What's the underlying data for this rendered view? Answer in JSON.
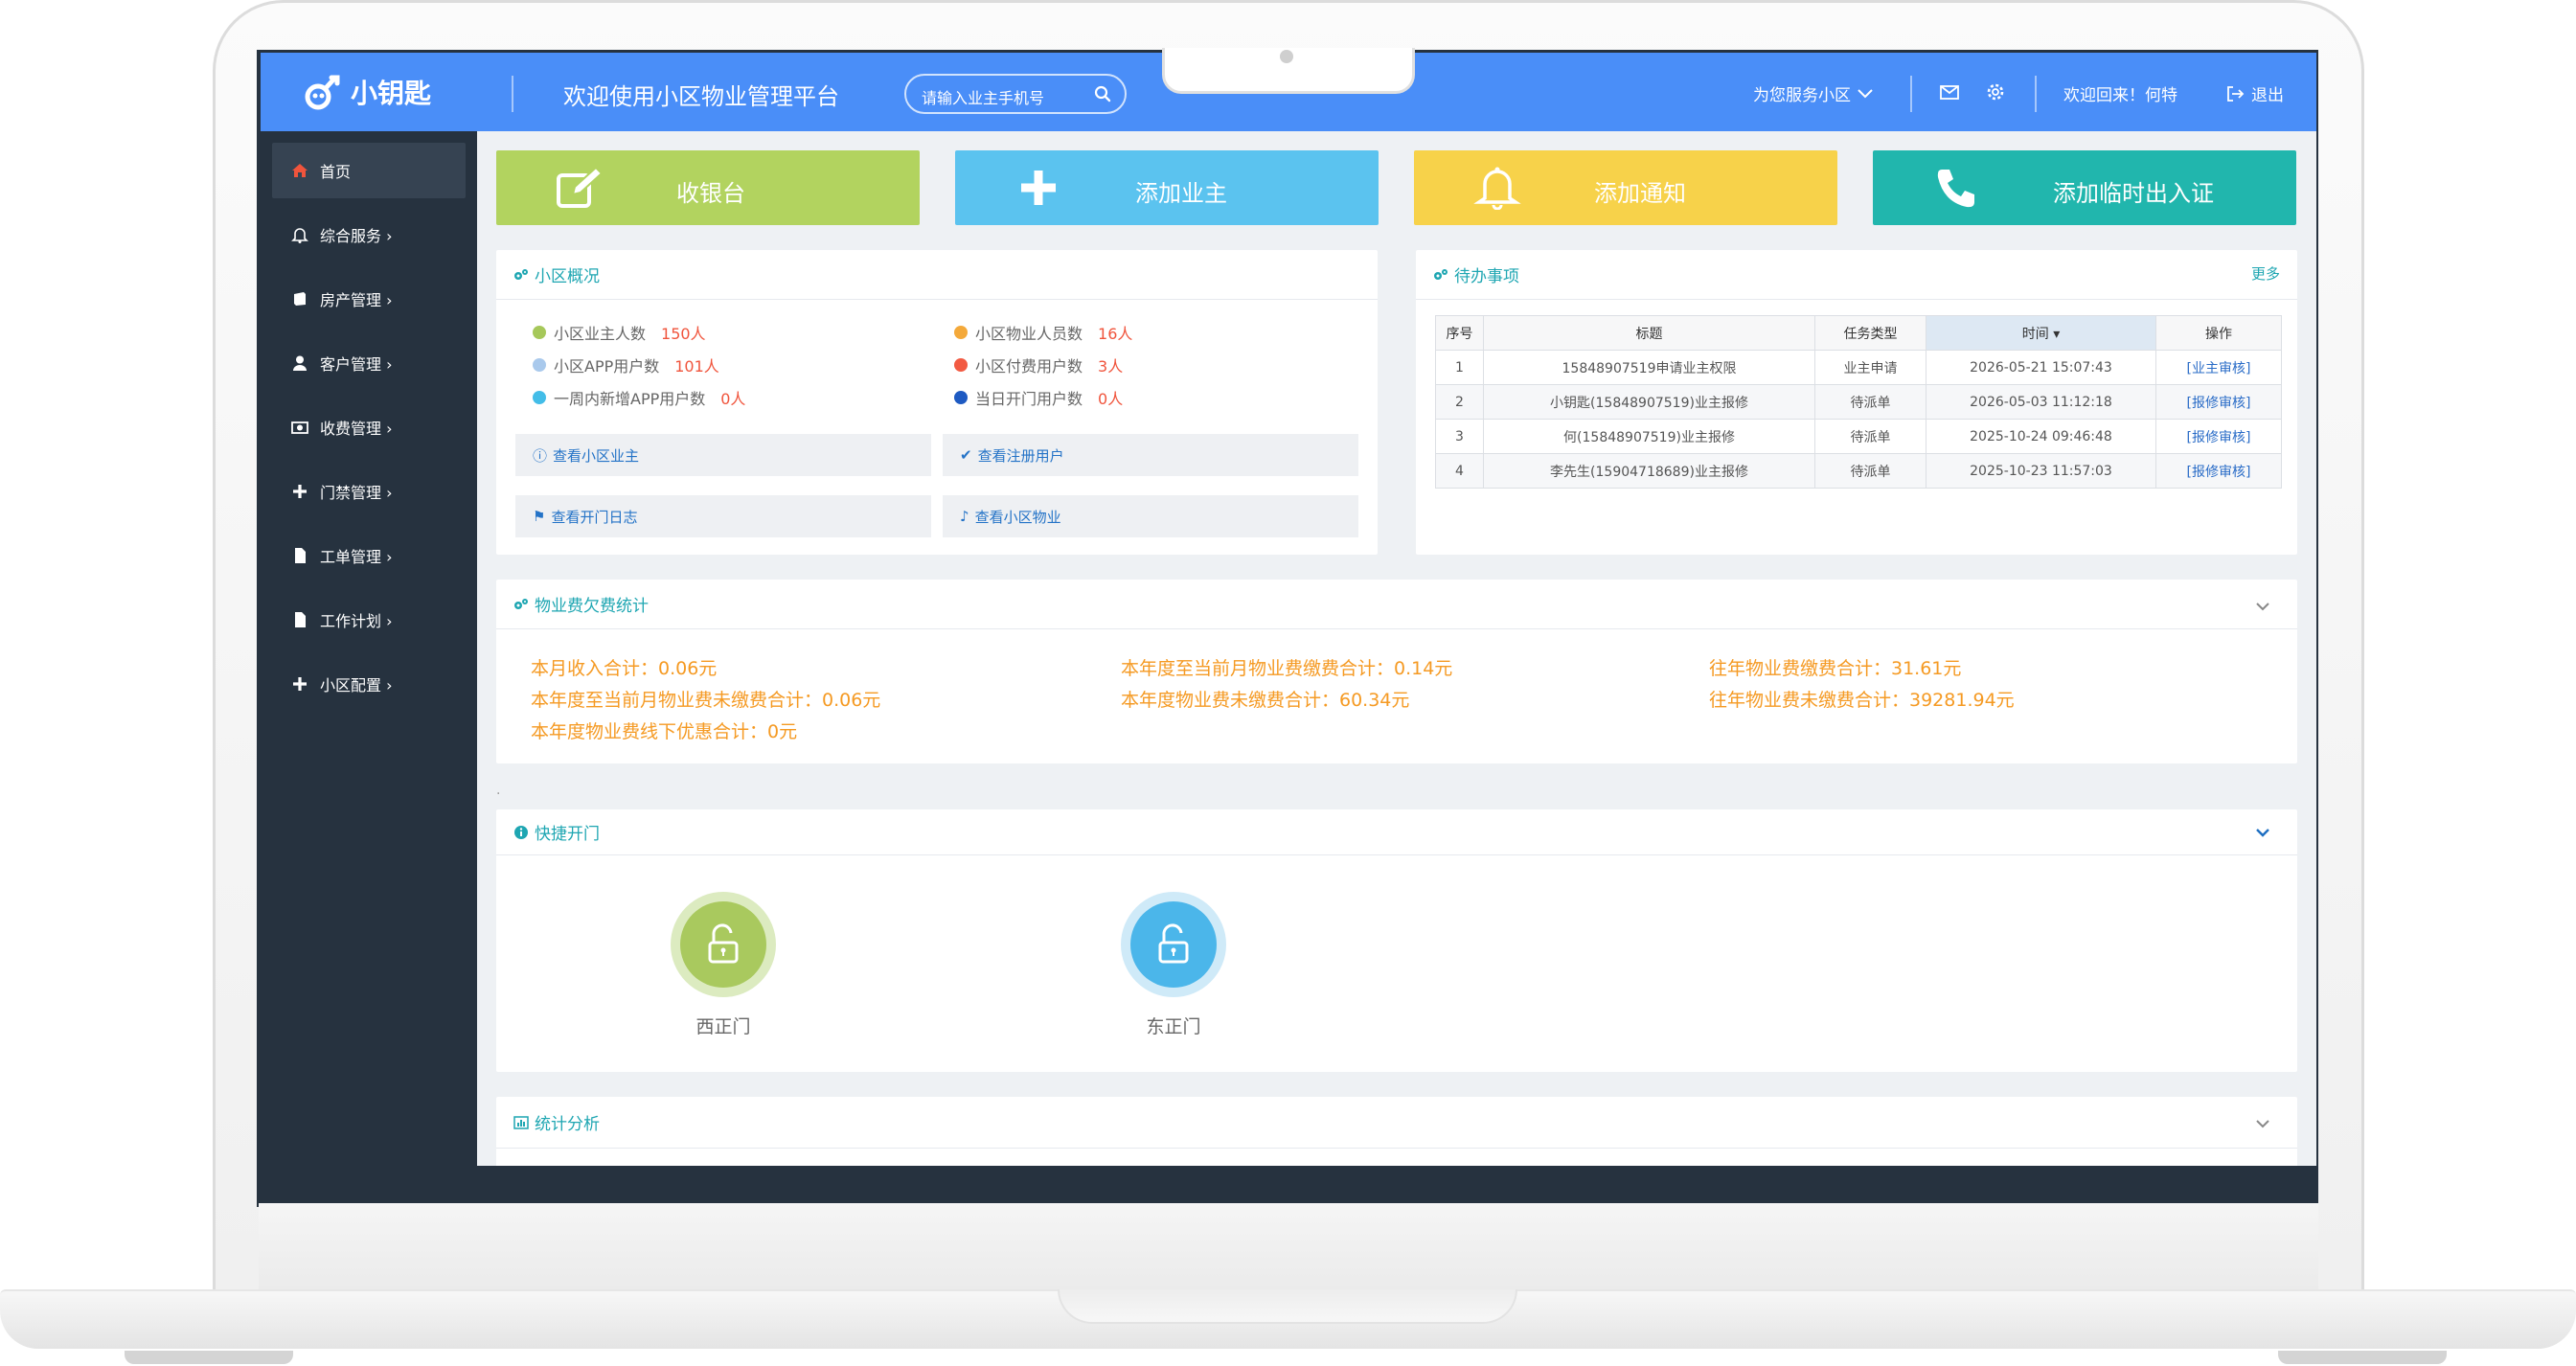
{
  "header": {
    "brand": "小钥匙",
    "title": "欢迎使用小区物业管理平台",
    "search_placeholder": "请输入业主手机号",
    "community_select": "为您服务小区",
    "welcome": "欢迎回来！何特",
    "logout": "退出"
  },
  "sidebar": {
    "items": [
      {
        "label": "首页",
        "icon": "home-icon",
        "active": true
      },
      {
        "label": "综合服务 ›",
        "icon": "bell-icon"
      },
      {
        "label": "房产管理 ›",
        "icon": "book-icon"
      },
      {
        "label": "客户管理 ›",
        "icon": "user-icon"
      },
      {
        "label": "收费管理 ›",
        "icon": "money-icon"
      },
      {
        "label": "门禁管理 ›",
        "icon": "plus-icon"
      },
      {
        "label": "工单管理 ›",
        "icon": "file-icon"
      },
      {
        "label": "工作计划 ›",
        "icon": "file-icon"
      },
      {
        "label": "小区配置 ›",
        "icon": "plus-icon"
      }
    ]
  },
  "quick_actions": [
    {
      "label": "收银台",
      "icon": "edit-icon",
      "color": "#b2d35f"
    },
    {
      "label": "添加业主",
      "icon": "plus-icon",
      "color": "#5bc3ef"
    },
    {
      "label": "添加通知",
      "icon": "bell-icon",
      "color": "#f7d24a"
    },
    {
      "label": "添加临时出入证",
      "icon": "phone-icon",
      "color": "#21b6ad"
    }
  ],
  "overview": {
    "title": "小区概况",
    "stats": [
      {
        "label": "小区业主人数",
        "value": "150人",
        "color": "#a6c85a"
      },
      {
        "label": "小区物业人员数",
        "value": "16人",
        "color": "#f4a93a"
      },
      {
        "label": "小区APP用户数",
        "value": "101人",
        "color": "#a9c9ec"
      },
      {
        "label": "小区付费用户数",
        "value": "3人",
        "color": "#f25a42"
      },
      {
        "label": "一周内新增APP用户数",
        "value": "0人",
        "color": "#43bde8"
      },
      {
        "label": "当日开门用户数",
        "value": "0人",
        "color": "#1e5ac2"
      }
    ],
    "links": [
      {
        "label": "查看小区业主",
        "icon": "info-icon"
      },
      {
        "label": "查看注册用户",
        "icon": "check-icon"
      },
      {
        "label": "查看开门日志",
        "icon": "tag-icon"
      },
      {
        "label": "查看小区物业",
        "icon": "bell-icon"
      }
    ]
  },
  "todo": {
    "title": "待办事项",
    "more": "更多",
    "columns": [
      "序号",
      "标题",
      "任务类型",
      "时间 ▾",
      "操作"
    ],
    "rows": [
      [
        "1",
        "15848907519申请业主权限",
        "业主申请",
        "2026-05-21 15:07:43",
        "[业主审核]"
      ],
      [
        "2",
        "小钥匙(15848907519)业主报修",
        "待派单",
        "2026-05-03 11:12:18",
        "[报修审核]"
      ],
      [
        "3",
        "何(15848907519)业主报修",
        "待派单",
        "2025-10-24 09:46:48",
        "[报修审核]"
      ],
      [
        "4",
        "李先生(15904718689)业主报修",
        "待派单",
        "2025-10-23 11:57:03",
        "[报修审核]"
      ]
    ]
  },
  "fees": {
    "title": "物业费欠费统计",
    "items": [
      "本月收入合计：0.06元",
      "本年度至当前月物业费缴费合计：0.14元",
      "往年物业费缴费合计：31.61元",
      "本年度至当前月物业费未缴费合计：0.06元",
      "本年度物业费未缴费合计：60.34元",
      "往年物业费未缴费合计：39281.94元",
      "本年度物业费线下优惠合计：0元"
    ]
  },
  "quick_open": {
    "title": "快捷开门",
    "doors": [
      {
        "label": "西正门",
        "color": "#a9c95e"
      },
      {
        "label": "东正门",
        "color": "#4bb6ea"
      }
    ]
  },
  "stats_panel": {
    "title": "统计分析"
  },
  "misc_dot": "."
}
